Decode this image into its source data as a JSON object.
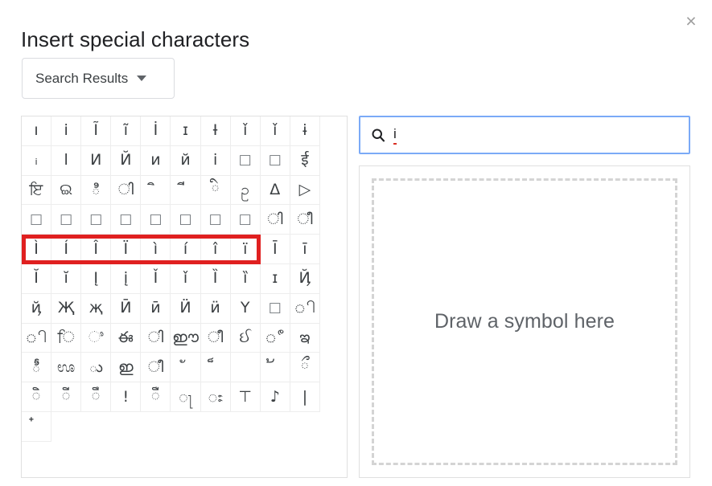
{
  "dialog": {
    "title": "Insert special characters",
    "close_label": "×"
  },
  "category": {
    "selected": "Search Results",
    "caret_icon": "chevron-down-icon"
  },
  "search": {
    "icon": "search-icon",
    "value": "i",
    "spellcheck_underline_color": "#d93025"
  },
  "draw": {
    "placeholder": "Draw a symbol here"
  },
  "selection": {
    "highlight_color": "#e02020",
    "row_index": 4,
    "first_column": 0,
    "last_column": 7,
    "characters": [
      "Ì",
      "Í",
      "Î",
      "Ï",
      "ì",
      "í",
      "î",
      "ï"
    ]
  },
  "grid": {
    "columns": 10,
    "rows": 11,
    "total_cells": 101,
    "characters": [
      "ı",
      "i",
      "Ĩ",
      "ĩ",
      "İ",
      "ɪ",
      "Ɨ",
      "ǐ",
      "ǐ",
      "ɨ",
      "ᵢ",
      "l",
      "И",
      "Й",
      "и",
      "й",
      "і",
      "□",
      "□",
      "ई",
      "ਇ",
      "ଇ",
      "ి",
      "ി",
      "ิ",
      "ี",
      "ི",
      "ဥ",
      "Δ",
      "▷",
      "□",
      "□",
      "□",
      "□",
      "□",
      "□",
      "□",
      "□",
      "ി",
      "ീ",
      "Ì",
      "Í",
      "Î",
      "Ï",
      "ì",
      "í",
      "î",
      "ï",
      "Ī",
      "ī",
      "Ĭ",
      "ĭ",
      "Į",
      "į",
      "Ǐ",
      "ǐ",
      "Ȉ",
      "ȉ",
      "ɪ",
      "Ҋ",
      "ҋ",
      "Җ",
      "җ",
      "Ӣ",
      "ӣ",
      "Ӥ",
      "ӥ",
      "Ү",
      "□",
      "ி",
      "ி",
      "ਿ",
      "ಿ",
      "ఈ",
      "ി",
      "ഈ",
      "ീ",
      "ઈ",
      "ீ",
      "ఇ",
      "ీ",
      "ಊ",
      "ు",
      "ഇ",
      "ീ",
      "ั",
      "็",
      "຿",
      "້",
      "ྀ",
      "ិ",
      "ី",
      "ឹ",
      "!",
      "ឺ",
      "ႃ",
      "ႜ",
      "⊤",
      "♪",
      "|",
      "໋"
    ]
  }
}
